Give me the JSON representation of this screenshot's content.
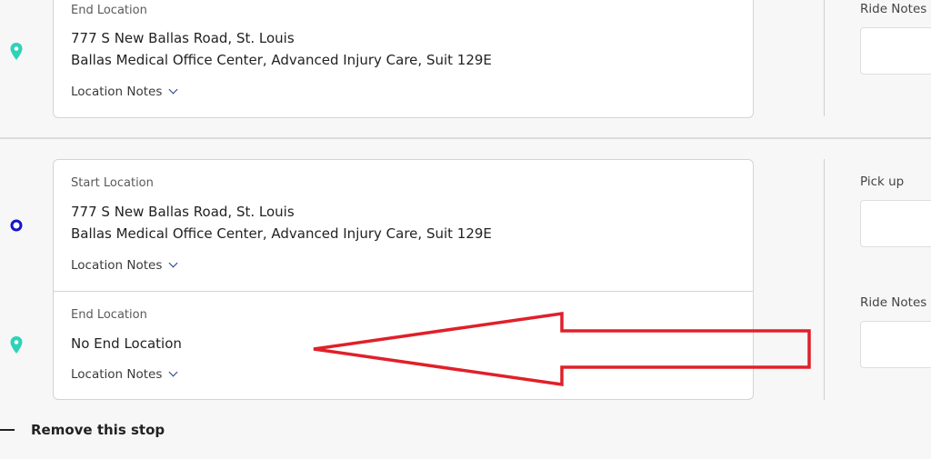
{
  "stop_one": {
    "end": {
      "label": "End Location",
      "address_line1": "777 S New Ballas Road, St. Louis",
      "address_line2": "Ballas Medical Office Center, Advanced Injury Care, Suit 129E",
      "notes_label": "Location Notes"
    },
    "right": {
      "ride_notes_label": "Ride Notes"
    }
  },
  "stop_two": {
    "start": {
      "label": "Start Location",
      "address_line1": "777 S New Ballas Road, St. Louis",
      "address_line2": "Ballas Medical Office Center, Advanced Injury Care, Suit 129E",
      "notes_label": "Location Notes"
    },
    "end": {
      "label": "End Location",
      "address_line1": "No End Location",
      "notes_label": "Location Notes"
    },
    "right": {
      "pickup_label": "Pick up",
      "ride_notes_label": "Ride Notes"
    }
  },
  "actions": {
    "remove_stop_label": "Remove this stop"
  },
  "icons": {
    "end_marker": "map-pin-icon",
    "start_marker": "circle-marker-icon",
    "chevron": "chevron-down-icon",
    "remove": "minus-icon"
  },
  "colors": {
    "pin": "#2ed3b7",
    "start_marker": "#1414c8",
    "chevron": "#1f3a8a",
    "annotation_arrow": "#e0202a"
  }
}
